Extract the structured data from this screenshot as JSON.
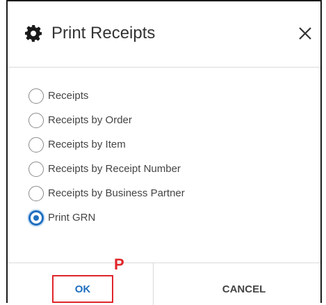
{
  "dialog": {
    "title": "Print Receipts",
    "title_icon": "gear-icon",
    "close_icon": "close-icon",
    "options": [
      {
        "label": "Receipts",
        "checked": false
      },
      {
        "label": "Receipts by Order",
        "checked": false
      },
      {
        "label": "Receipts by Item",
        "checked": false
      },
      {
        "label": "Receipts by Receipt Number",
        "checked": false
      },
      {
        "label": "Receipts by Business Partner",
        "checked": false
      },
      {
        "label": "Print GRN",
        "checked": true
      }
    ],
    "ok_label": "OK",
    "cancel_label": "CANCEL"
  },
  "annotation": {
    "marker_label": "P"
  },
  "colors": {
    "accent": "#1f6fbf",
    "highlight": "#e0262b",
    "text": "#444444"
  }
}
